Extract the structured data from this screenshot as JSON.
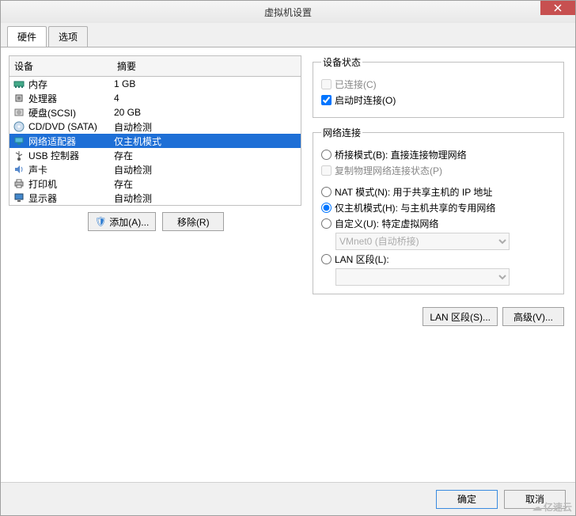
{
  "window": {
    "title": "虚拟机设置"
  },
  "tabs": {
    "hardware": "硬件",
    "options": "选项",
    "active": "hardware"
  },
  "headers": {
    "device": "设备",
    "summary": "摘要"
  },
  "devices": [
    {
      "id": "memory",
      "icon": "memory-icon",
      "label": "内存",
      "summary": "1 GB",
      "selected": false
    },
    {
      "id": "cpu",
      "icon": "cpu-icon",
      "label": "处理器",
      "summary": "4",
      "selected": false
    },
    {
      "id": "hdd",
      "icon": "hdd-icon",
      "label": "硬盘(SCSI)",
      "summary": "20 GB",
      "selected": false
    },
    {
      "id": "cddvd",
      "icon": "disc-icon",
      "label": "CD/DVD (SATA)",
      "summary": "自动检测",
      "selected": false
    },
    {
      "id": "net",
      "icon": "network-icon",
      "label": "网络适配器",
      "summary": "仅主机模式",
      "selected": true
    },
    {
      "id": "usb",
      "icon": "usb-icon",
      "label": "USB 控制器",
      "summary": "存在",
      "selected": false
    },
    {
      "id": "sound",
      "icon": "sound-icon",
      "label": "声卡",
      "summary": "自动检测",
      "selected": false
    },
    {
      "id": "printer",
      "icon": "printer-icon",
      "label": "打印机",
      "summary": "存在",
      "selected": false
    },
    {
      "id": "display",
      "icon": "display-icon",
      "label": "显示器",
      "summary": "自动检测",
      "selected": false
    }
  ],
  "status": {
    "legend": "设备状态",
    "connected_label": "已连接(C)",
    "connected_checked": false,
    "connected_enabled": false,
    "connect_power_label": "启动时连接(O)",
    "connect_power_checked": true
  },
  "network": {
    "legend": "网络连接",
    "bridged_label": "桥接模式(B): 直接连接物理网络",
    "replicate_label": "复制物理网络连接状态(P)",
    "replicate_enabled": false,
    "nat_label": "NAT 模式(N): 用于共享主机的 IP 地址",
    "hostonly_label": "仅主机模式(H): 与主机共享的专用网络",
    "custom_label": "自定义(U): 特定虚拟网络",
    "custom_value": "VMnet0 (自动桥接)",
    "custom_enabled": false,
    "lanseg_label": "LAN 区段(L):",
    "lanseg_enabled": false,
    "selected": "hostonly"
  },
  "buttons": {
    "lan_segments": "LAN 区段(S)...",
    "advanced": "高级(V)...",
    "add": "添加(A)...",
    "remove": "移除(R)",
    "ok": "确定",
    "cancel": "取消"
  },
  "watermark": "亿速云"
}
